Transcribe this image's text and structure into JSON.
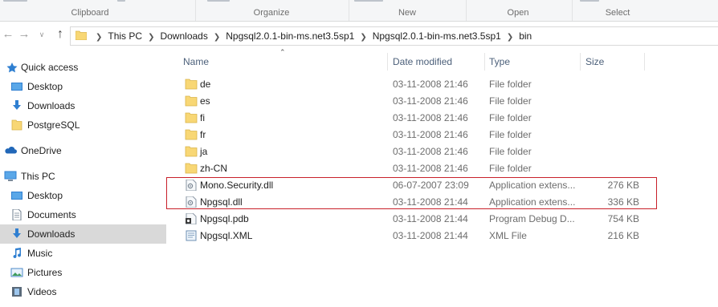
{
  "ribbon": {
    "groups": [
      "Clipboard",
      "Organize",
      "New",
      "Open",
      "Select"
    ],
    "colors": {
      "background": "#f5f6f7",
      "label": "#6d6d6d"
    }
  },
  "address": {
    "crumbs": [
      "This PC",
      "Downloads",
      "Npgsql2.0.1-bin-ms.net3.5sp1",
      "Npgsql2.0.1-bin-ms.net3.5sp1",
      "bin"
    ]
  },
  "sidebar": {
    "items": [
      {
        "label": "Quick access",
        "icon": "star-icon"
      },
      {
        "label": "Desktop",
        "icon": "desktop-icon"
      },
      {
        "label": "Downloads",
        "icon": "download-arrow-icon"
      },
      {
        "label": "PostgreSQL",
        "icon": "folder-icon"
      },
      {
        "label": "OneDrive",
        "icon": "cloud-icon"
      },
      {
        "label": "This PC",
        "icon": "computer-icon"
      },
      {
        "label": "Desktop",
        "icon": "desktop-icon"
      },
      {
        "label": "Documents",
        "icon": "document-icon"
      },
      {
        "label": "Downloads",
        "icon": "download-arrow-icon"
      },
      {
        "label": "Music",
        "icon": "music-note-icon"
      },
      {
        "label": "Pictures",
        "icon": "picture-icon"
      },
      {
        "label": "Videos",
        "icon": "film-icon"
      }
    ],
    "selected_color": "#d9d9d9"
  },
  "columns": {
    "name": "Name",
    "date": "Date modified",
    "type": "Type",
    "size": "Size"
  },
  "files": [
    {
      "name": "de",
      "date": "03-11-2008 21:46",
      "type": "File folder",
      "size": "",
      "icon": "folder-icon"
    },
    {
      "name": "es",
      "date": "03-11-2008 21:46",
      "type": "File folder",
      "size": "",
      "icon": "folder-icon"
    },
    {
      "name": "fi",
      "date": "03-11-2008 21:46",
      "type": "File folder",
      "size": "",
      "icon": "folder-icon"
    },
    {
      "name": "fr",
      "date": "03-11-2008 21:46",
      "type": "File folder",
      "size": "",
      "icon": "folder-icon"
    },
    {
      "name": "ja",
      "date": "03-11-2008 21:46",
      "type": "File folder",
      "size": "",
      "icon": "folder-icon"
    },
    {
      "name": "zh-CN",
      "date": "03-11-2008 21:46",
      "type": "File folder",
      "size": "",
      "icon": "folder-icon"
    },
    {
      "name": "Mono.Security.dll",
      "date": "06-07-2007 23:09",
      "type": "Application extens...",
      "size": "276 KB",
      "icon": "dll-file-icon"
    },
    {
      "name": "Npgsql.dll",
      "date": "03-11-2008 21:44",
      "type": "Application extens...",
      "size": "336 KB",
      "icon": "dll-file-icon"
    },
    {
      "name": "Npgsql.pdb",
      "date": "03-11-2008 21:44",
      "type": "Program Debug D...",
      "size": "754 KB",
      "icon": "pdb-file-icon"
    },
    {
      "name": "Npgsql.XML",
      "date": "03-11-2008 21:44",
      "type": "XML File",
      "size": "216 KB",
      "icon": "xml-file-icon"
    }
  ],
  "colors": {
    "highlight_box": "#c8202a",
    "folder": "#f8d775",
    "header_text": "#4c607a"
  }
}
